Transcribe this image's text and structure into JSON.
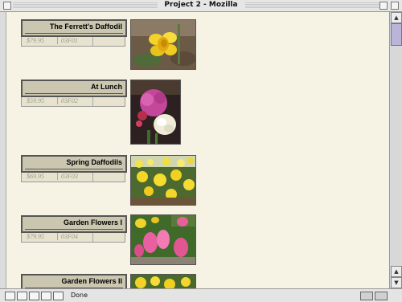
{
  "window": {
    "title": "Project 2 - Mozilla"
  },
  "products": [
    {
      "name": "The Ferrett's Daffodil",
      "price": "$79.95",
      "sku": "03F01"
    },
    {
      "name": "At Lunch",
      "price": "$59.95",
      "sku": "03F02"
    },
    {
      "name": "Spring Daffodils",
      "price": "$69.95",
      "sku": "03F03"
    },
    {
      "name": "Garden Flowers I",
      "price": "$79.95",
      "sku": "03F04"
    },
    {
      "name": "Garden Flowers II",
      "price": "",
      "sku": ""
    }
  ],
  "status": {
    "text": "Done"
  },
  "icons": [
    "close-box-icon",
    "zoom-box-icon",
    "collapse-box-icon",
    "navigator-icon",
    "mail-icon",
    "composer-icon",
    "address-book-icon",
    "irc-icon",
    "security-lock-icon"
  ]
}
